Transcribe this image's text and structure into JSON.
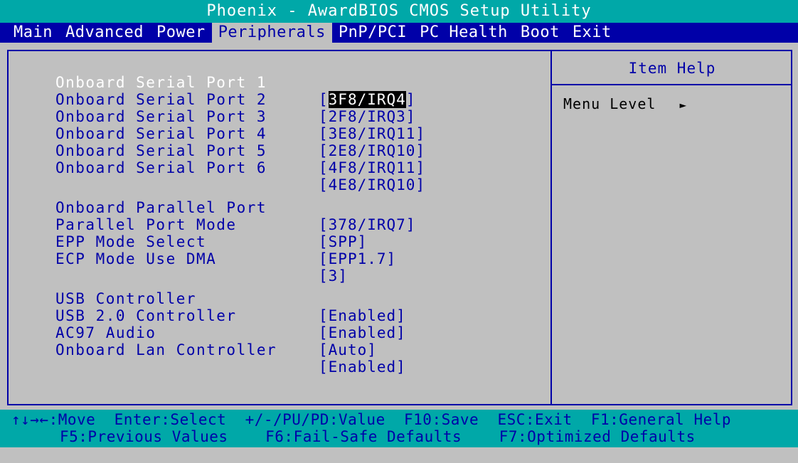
{
  "title": "Phoenix - AwardBIOS CMOS Setup Utility",
  "menu": [
    {
      "label": "Main",
      "active": false
    },
    {
      "label": "Advanced",
      "active": false
    },
    {
      "label": "Power",
      "active": false
    },
    {
      "label": "Peripherals",
      "active": true
    },
    {
      "label": "PnP/PCI",
      "active": false
    },
    {
      "label": "PC Health",
      "active": false
    },
    {
      "label": "Boot",
      "active": false
    },
    {
      "label": "Exit",
      "active": false
    }
  ],
  "settings": [
    {
      "label": "Onboard Serial Port 1",
      "value": "3F8/IRQ4",
      "selected": true
    },
    {
      "label": "Onboard Serial Port 2",
      "value": "2F8/IRQ3"
    },
    {
      "label": "Onboard Serial Port 3",
      "value": "3E8/IRQ11"
    },
    {
      "label": "Onboard Serial Port 4",
      "value": "2E8/IRQ10"
    },
    {
      "label": "Onboard Serial Port 5",
      "value": "4F8/IRQ11"
    },
    {
      "label": "Onboard Serial Port 6",
      "value": "4E8/IRQ10"
    },
    {
      "label": "Onboard Parallel Port",
      "value": "378/IRQ7"
    },
    {
      "label": "Parallel Port Mode",
      "value": "SPP"
    },
    {
      "label": "EPP Mode Select",
      "value": "EPP1.7"
    },
    {
      "label": "ECP Mode Use DMA",
      "value": "3"
    },
    {
      "label": "USB Controller",
      "value": "Enabled"
    },
    {
      "label": "USB 2.0 Controller",
      "value": "Enabled"
    },
    {
      "label": "AC97 Audio",
      "value": "Auto"
    },
    {
      "label": "Onboard Lan Controller",
      "value": "Enabled"
    }
  ],
  "help": {
    "title": "Item Help",
    "menu_level_label": "Menu Level",
    "menu_level_arrow": "►"
  },
  "footer": {
    "line1": "↑↓→←:Move  Enter:Select  +/-/PU/PD:Value  F10:Save  ESC:Exit  F1:General Help",
    "line2": "F5:Previous Values    F6:Fail-Safe Defaults    F7:Optimized Defaults"
  },
  "colors": {
    "background": "#c0c0c0",
    "title_bar": "#00a8a8",
    "menu_bar": "#0000a8",
    "text": "#0000a8",
    "selected_value_bg": "#000000"
  }
}
